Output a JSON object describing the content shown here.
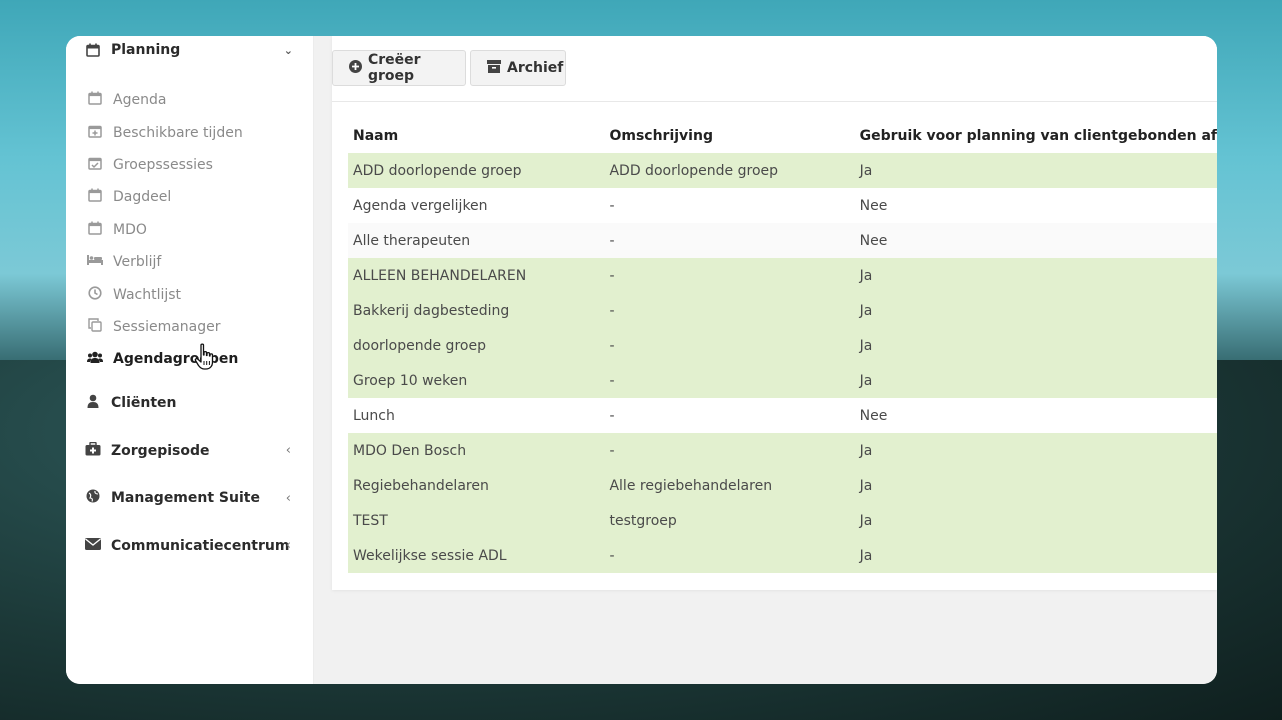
{
  "sidebar": {
    "planning_label": "Planning",
    "planning_items": [
      {
        "label": "Agenda",
        "icon": "calendar-icon"
      },
      {
        "label": "Beschikbare tijden",
        "icon": "calendar-plus-icon"
      },
      {
        "label": "Groepssessies",
        "icon": "calendar-check-icon"
      },
      {
        "label": "Dagdeel",
        "icon": "calendar-icon"
      },
      {
        "label": "MDO",
        "icon": "calendar-icon"
      },
      {
        "label": "Verblijf",
        "icon": "bed-icon"
      },
      {
        "label": "Wachtlijst",
        "icon": "clock-icon"
      },
      {
        "label": "Sessiemanager",
        "icon": "copy-icon"
      },
      {
        "label": "Agendagroepen",
        "icon": "users-icon"
      }
    ],
    "sections": [
      {
        "label": "Cliënten",
        "icon": "user-icon",
        "has_chevron": false
      },
      {
        "label": "Zorgepisode",
        "icon": "medkit-icon",
        "has_chevron": true
      },
      {
        "label": "Management Suite",
        "icon": "globe-icon",
        "has_chevron": true
      },
      {
        "label": "Communicatiecentrum",
        "icon": "envelope-icon",
        "has_chevron": true
      }
    ]
  },
  "toolbar": {
    "create_label": "Creëer groep",
    "archive_label": "Archief"
  },
  "table": {
    "headers": [
      "Naam",
      "Omschrijving",
      "Gebruik voor planning van clientgebonden af"
    ],
    "rows": [
      {
        "naam": "ADD doorlopende groep",
        "omschrijving": "ADD doorlopende groep",
        "gebruik": "Ja"
      },
      {
        "naam": "Agenda vergelijken",
        "omschrijving": "-",
        "gebruik": "Nee"
      },
      {
        "naam": "Alle therapeuten",
        "omschrijving": "-",
        "gebruik": "Nee"
      },
      {
        "naam": "ALLEEN BEHANDELAREN",
        "omschrijving": "-",
        "gebruik": "Ja"
      },
      {
        "naam": "Bakkerij dagbesteding",
        "omschrijving": "-",
        "gebruik": "Ja"
      },
      {
        "naam": "doorlopende groep",
        "omschrijving": "-",
        "gebruik": "Ja"
      },
      {
        "naam": "Groep 10 weken",
        "omschrijving": "-",
        "gebruik": "Ja"
      },
      {
        "naam": "Lunch",
        "omschrijving": "-",
        "gebruik": "Nee"
      },
      {
        "naam": "MDO Den Bosch",
        "omschrijving": "-",
        "gebruik": "Ja"
      },
      {
        "naam": "Regiebehandelaren",
        "omschrijving": "Alle regiebehandelaren",
        "gebruik": "Ja"
      },
      {
        "naam": "TEST",
        "omschrijving": "testgroep",
        "gebruik": "Ja"
      },
      {
        "naam": "Wekelijkse sessie ADL",
        "omschrijving": "-",
        "gebruik": "Ja"
      }
    ]
  },
  "colors": {
    "row_yes": "#e2f0cf",
    "row_no": "#ffffff"
  }
}
